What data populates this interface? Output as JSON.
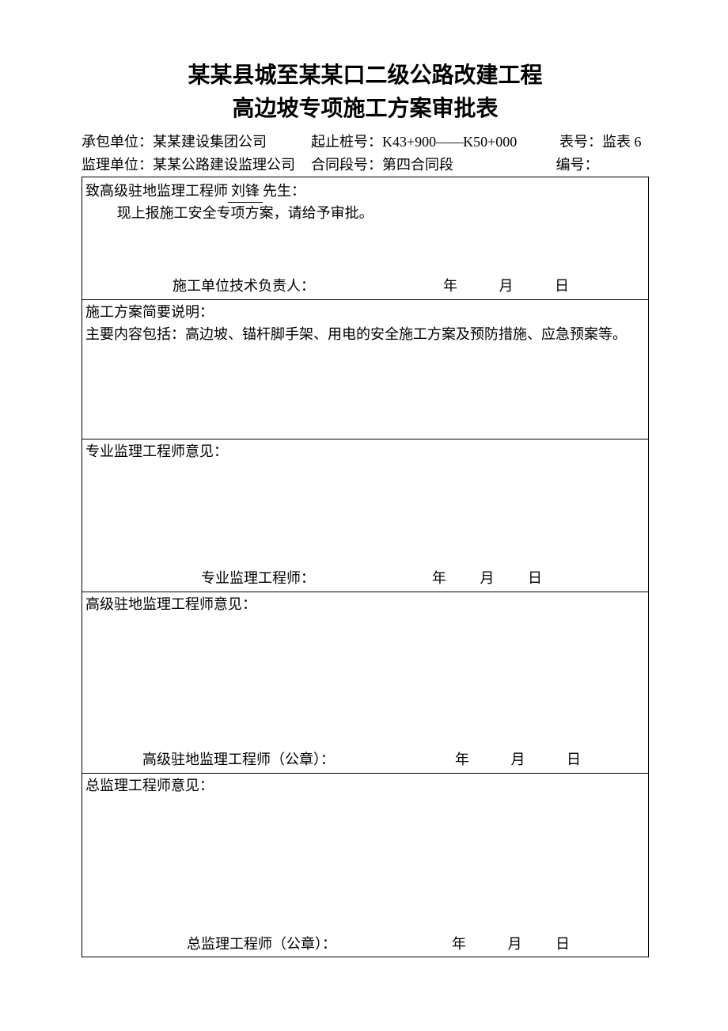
{
  "title1": "某某县城至某某口二级公路改建工程",
  "title2": "高边坡专项施工方案审批表",
  "meta": {
    "row1": {
      "contractor_label": "承包单位：",
      "contractor_value": "某某建设集团公司",
      "stake_label": "起止桩号：",
      "stake_value_pre": "K43+900",
      "stake_dash": "——",
      "stake_value_post": "K50+000",
      "formno_label": "表号：",
      "formno_value": "监表 6"
    },
    "row2": {
      "supervisor_label": "监理单位：",
      "supervisor_value": "某某公路建设监理公司",
      "section_label": "合同段号：",
      "section_value": "第四合同段",
      "serial_label": "编号："
    }
  },
  "cell1": {
    "line1_pre": "致高级驻地监理工程师",
    "line1_name": "刘锋",
    "line1_post": "先生：",
    "body": "现上报施工安全专项方案，请给予审批。",
    "sig_label": "施工单位技术负责人：",
    "year": "年",
    "month": "月",
    "day": "日"
  },
  "cell2": {
    "heading": "施工方案简要说明：",
    "body": "主要内容包括：高边坡、锚杆脚手架、用电的安全施工方案及预防措施、应急预案等。"
  },
  "cell3": {
    "heading": "专业监理工程师意见：",
    "sig_label": "专业监理工程师：",
    "year": "年",
    "month": "月",
    "day": "日"
  },
  "cell4": {
    "heading": "高级驻地监理工程师意见：",
    "sig_label": "高级驻地监理工程师（公章）：",
    "year": "年",
    "month": "月",
    "day": "日"
  },
  "cell5": {
    "heading": "总监理工程师意见：",
    "sig_label": "总监理工程师（公章）：",
    "year": "年",
    "month": "月",
    "day": "日"
  }
}
